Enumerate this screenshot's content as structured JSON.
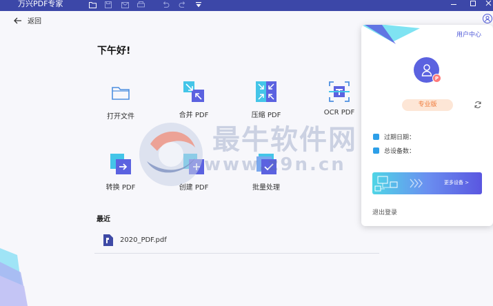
{
  "window": {
    "title": "万兴PDF专家"
  },
  "topbar": {
    "back_label": "返回"
  },
  "main": {
    "greeting": "下午好!",
    "tools": [
      {
        "label": "打开文件",
        "icon": "folder-icon"
      },
      {
        "label": "合并 PDF",
        "icon": "merge-icon"
      },
      {
        "label": "压缩 PDF",
        "icon": "compress-icon"
      },
      {
        "label": "OCR PDF",
        "icon": "ocr-icon"
      },
      {
        "label": "转换 PDF",
        "icon": "convert-icon"
      },
      {
        "label": "创建 PDF",
        "icon": "create-icon"
      },
      {
        "label": "批量处理",
        "icon": "batch-icon"
      }
    ],
    "recent_title": "最近",
    "recent_files": [
      {
        "name": "2020_PDF.pdf",
        "icon": "pdf-file-icon"
      }
    ]
  },
  "panel": {
    "user_center": "用户中心",
    "avatar_badge": "P",
    "edition": "专业版",
    "expiry_label": "过期日期：",
    "devices_label": "总设备数：",
    "banner_text": "更多设备 >",
    "logout": "退出登录"
  },
  "watermark": {
    "text_cn": "最牛软件网",
    "text_url": "www.z9n.cn"
  },
  "colors": {
    "titlebar": "#3c47a8",
    "accent": "#4e58d8",
    "pro_badge_bg": "#fde6d6",
    "pro_badge_text": "#f07a3a"
  }
}
